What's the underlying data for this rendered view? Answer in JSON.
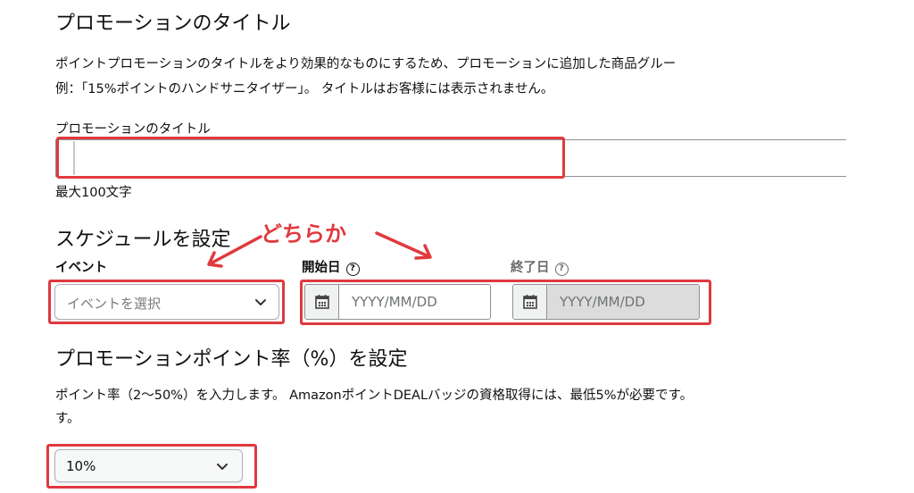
{
  "promo_title_section": {
    "heading": "プロモーションのタイトル",
    "description_line1": "ポイントプロモーションのタイトルをより効果的なものにするため、プロモーションに追加した商品グルー",
    "description_line2": "例：「15%ポイントのハンドサニタイザー」。 タイトルはお客様には表示されません。",
    "field_label": "プロモーションのタイトル",
    "field_value": "",
    "hint": "最大100文字"
  },
  "schedule_section": {
    "heading": "スケジュールを設定",
    "event_label": "イベント",
    "event_placeholder": "イベントを選択",
    "start_label": "開始日",
    "start_placeholder": "YYYY/MM/DD",
    "end_label": "終了日",
    "end_placeholder": "YYYY/MM/DD",
    "help_glyph": "?"
  },
  "annotation": {
    "text": "どちらか",
    "color": "#e0393e"
  },
  "rate_section": {
    "heading": "プロモーションポイント率（%）を設定",
    "description_line1": "ポイント率（2〜50%）を入力します。 AmazonポイントDEALバッジの資格取得には、最低5%が必要です。",
    "description_line2": "す。",
    "selected_value": "10%"
  },
  "icons": {
    "calendar": "calendar-icon",
    "chevron": "chevron-down-icon",
    "help": "help-circle-icon"
  }
}
